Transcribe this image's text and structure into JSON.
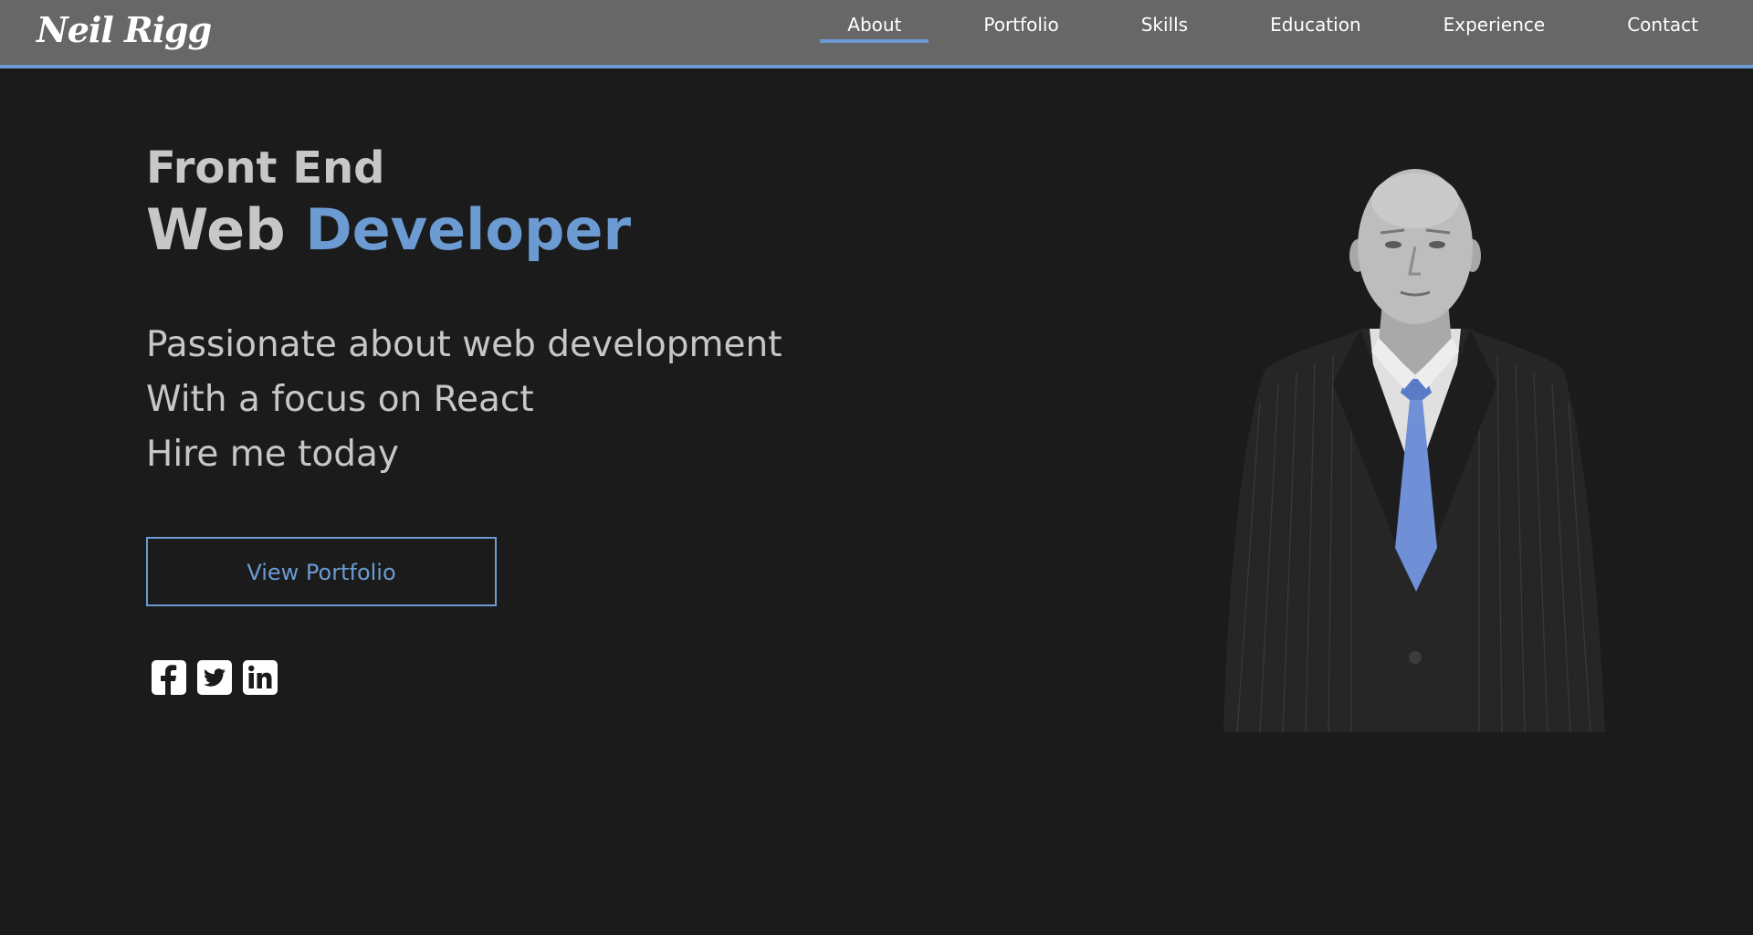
{
  "brand": "Neil Rigg",
  "nav": {
    "items": [
      {
        "label": "About",
        "active": true
      },
      {
        "label": "Portfolio"
      },
      {
        "label": "Skills"
      },
      {
        "label": "Education"
      },
      {
        "label": "Experience"
      },
      {
        "label": "Contact"
      }
    ]
  },
  "hero": {
    "line1": "Front End",
    "line2_prefix": "Web ",
    "line2_accent": "Developer",
    "taglines": [
      "Passionate about web development",
      "With a focus on React",
      "Hire me today"
    ],
    "cta_label": "View Portfolio"
  },
  "socials": [
    "facebook-icon",
    "twitter-icon",
    "linkedin-icon"
  ],
  "colors": {
    "accent": "#6b9bd2",
    "background": "#1b1b1b",
    "navbar": "#676767",
    "text": "#c7c7c7"
  }
}
